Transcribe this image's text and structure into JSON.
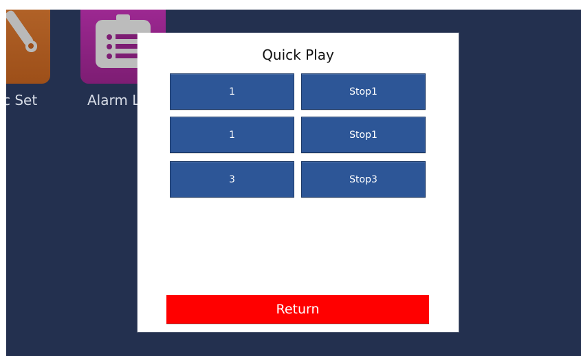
{
  "desktop": {
    "apps": [
      {
        "label": "c Set"
      },
      {
        "label": "Alarm L"
      }
    ]
  },
  "dialog": {
    "title": "Quick Play",
    "buttons": [
      {
        "left": "1",
        "right": "Stop1"
      },
      {
        "left": "1",
        "right": "Stop1"
      },
      {
        "left": "3",
        "right": "Stop3"
      }
    ],
    "return_label": "Return"
  },
  "colors": {
    "background": "#23304f",
    "button_blue": "#2d5697",
    "return_red": "#ff0000"
  }
}
